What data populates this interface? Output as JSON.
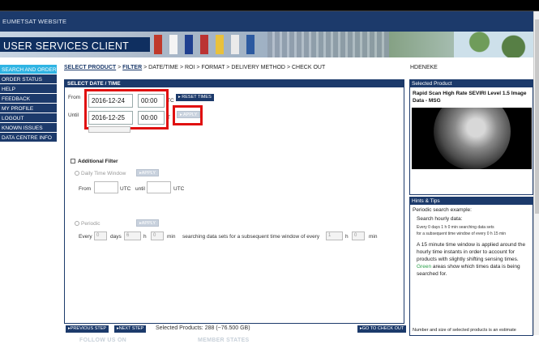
{
  "site": {
    "link": "EUMETSAT WEBSITE",
    "title": "USER SERVICES CLIENT"
  },
  "nav": {
    "items": [
      "SEARCH AND ORDER",
      "ORDER STATUS",
      "HELP",
      "FEEDBACK",
      "MY PROFILE",
      "LOGOUT",
      "KNOWN ISSUES",
      "DATA CENTRE INFO"
    ],
    "active_index": 0
  },
  "breadcrumb": {
    "select_product": "SELECT PRODUCT",
    "filter": "FILTER",
    "date_time": "DATE/TIME",
    "roi": "ROI",
    "format": "FORMAT",
    "delivery": "DELIVERY METHOD",
    "checkout": "CHECK OUT",
    "sep": ">"
  },
  "main": {
    "header": "SELECT DATE / TIME",
    "from_label": "From",
    "until_label": "Until",
    "from_date": "2016-12-24",
    "from_time": "00:00",
    "until_date": "2016-12-25",
    "until_time": "00:00",
    "utc_partial": "TC",
    "t_partial": "T",
    "reset_times": "RESET TIMES",
    "apply": "APPLY",
    "additional_filter": "Additional Filter",
    "daily_time_window": "Daily Time Window",
    "daily_apply": "APPLY",
    "from_small": "From",
    "utc": "UTC",
    "until_small": "until",
    "periodic": "Periodic",
    "periodic_apply": "APPLY",
    "every": "Every",
    "every_val": "0",
    "days": "days",
    "days_val": "6",
    "h": "h",
    "h_val": "0",
    "min": "min",
    "subsequent": "searching data sets for a subsequent time window of every",
    "sub_val": "1",
    "h2_val": "0",
    "min2": "min"
  },
  "bottom": {
    "previous": "PREVIOUS STEP",
    "next": "NEXT STEP",
    "selected": "Selected Products: 288 (~76.500 GB)",
    "checkout": "GO TO CHECK OUT"
  },
  "footer": {
    "follow": "FOLLOW US ON",
    "member": "MEMBER STATES"
  },
  "right": {
    "user": "HDENEKE",
    "selected_header": "Selected Product",
    "product_title": "Rapid Scan High Rate SEVIRI Level 1.5 Image Data - MSG",
    "hints_header": "Hints & Tips",
    "hint_intro": "Periodic search example:",
    "hint_search": "Search hourly data:",
    "hint_mini_line1": "Every 0 days 1 h 0 min searching data sets",
    "hint_mini_line2": "for a subsequent time window of every 0 h 15 min",
    "hint_para_a": "A 15 minute time window is applied around the hourly time instants in order to account for products with slightly shifting sensing times.",
    "hint_green": "Green",
    "hint_para_b": "areas show which times data is being searched for.",
    "hint_footer": "Number and size of selected products is an estimate"
  }
}
